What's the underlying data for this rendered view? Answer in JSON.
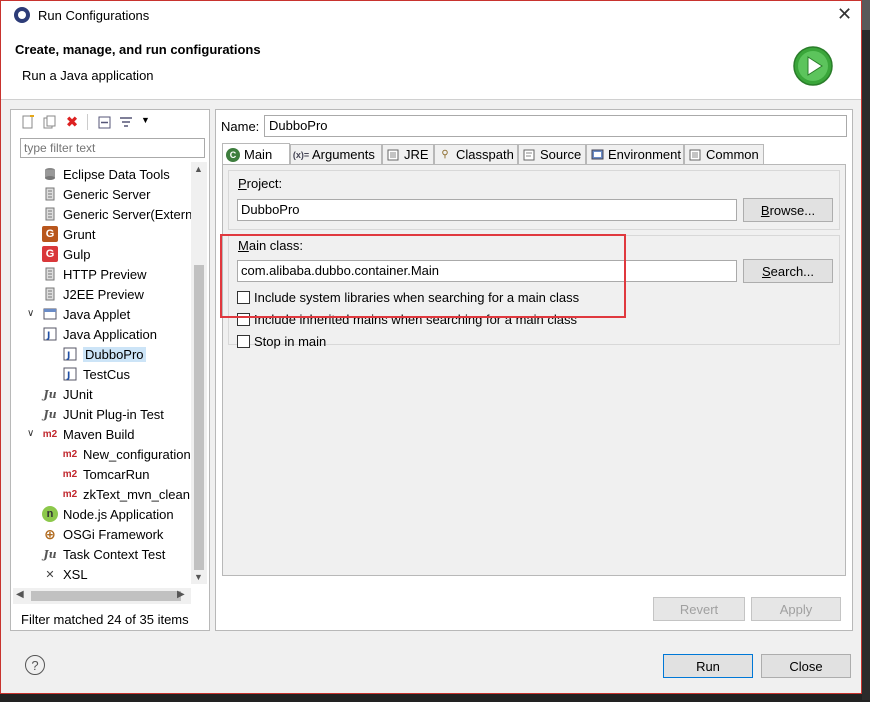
{
  "window": {
    "title": "Run Configurations",
    "close": "✕"
  },
  "header": {
    "title": "Create, manage, and run configurations",
    "subtitle": "Run a Java application"
  },
  "left": {
    "filter_placeholder": "type filter text",
    "status": "Filter matched 24 of 35 items",
    "tree": [
      {
        "label": "Eclipse Data Tools",
        "icon": "db-icon"
      },
      {
        "label": "Generic Server",
        "icon": "server-icon"
      },
      {
        "label": "Generic Server(Extern",
        "icon": "server-icon"
      },
      {
        "label": "Grunt",
        "icon": "grunt-icon"
      },
      {
        "label": "Gulp",
        "icon": "gulp-icon"
      },
      {
        "label": "HTTP Preview",
        "icon": "server-icon"
      },
      {
        "label": "J2EE Preview",
        "icon": "server-icon"
      },
      {
        "label": "Java Applet",
        "icon": "applet-icon"
      },
      {
        "label": "Java Application",
        "icon": "java-app-icon"
      },
      {
        "label": "DubboPro",
        "icon": "java-config-icon"
      },
      {
        "label": "TestCus",
        "icon": "java-config-icon"
      },
      {
        "label": "JUnit",
        "icon": "junit-icon"
      },
      {
        "label": "JUnit Plug-in Test",
        "icon": "junit-plugin-icon"
      },
      {
        "label": "Maven Build",
        "icon": "maven-icon"
      },
      {
        "label": "New_configuration",
        "icon": "maven-icon"
      },
      {
        "label": "TomcarRun",
        "icon": "maven-icon"
      },
      {
        "label": "zkText_mvn_clean",
        "icon": "maven-icon"
      },
      {
        "label": "Node.js Application",
        "icon": "nodejs-icon"
      },
      {
        "label": "OSGi Framework",
        "icon": "osgi-icon"
      },
      {
        "label": "Task Context Test",
        "icon": "task-icon"
      },
      {
        "label": "XSL",
        "icon": "xsl-icon"
      }
    ]
  },
  "right": {
    "name_label": "Name:",
    "name_value": "DubboPro",
    "tabs": [
      "Main",
      "Arguments",
      "JRE",
      "Classpath",
      "Source",
      "Environment",
      "Common"
    ],
    "project_label": "Project:",
    "project_value": "DubboPro",
    "browse": "Browse...",
    "main_class_label": "Main class:",
    "main_class_value": "com.alibaba.dubbo.container.Main",
    "search": "Search...",
    "include_system": "Include system libraries when searching for a main class",
    "include_inherited": "Include inherited mains when searching for a main class",
    "stop_in_main": "Stop in main",
    "revert": "Revert",
    "apply": "Apply"
  },
  "footer": {
    "run": "Run",
    "close": "Close",
    "help": "?"
  },
  "colors": {
    "accent": "#0078d7",
    "highlight": "#e0383e",
    "selection": "#cce4f7"
  }
}
